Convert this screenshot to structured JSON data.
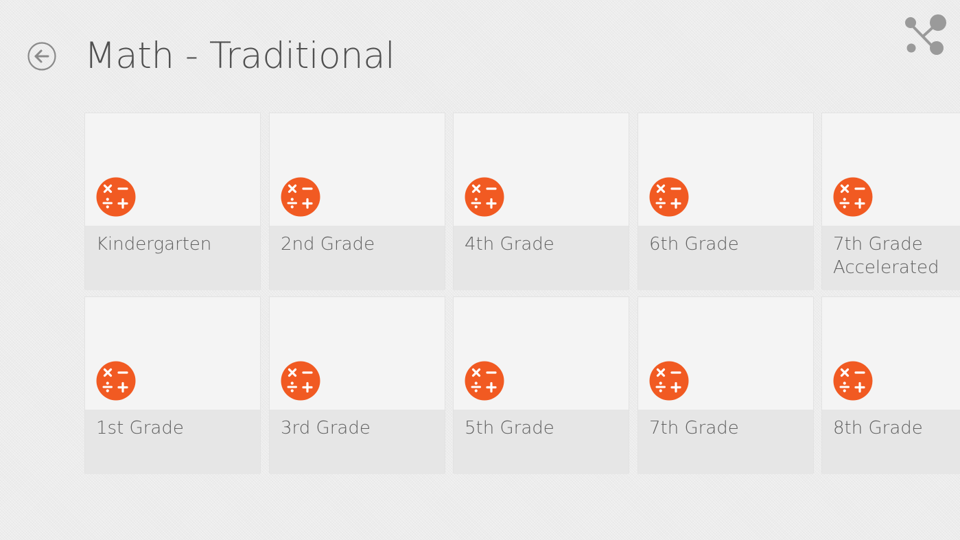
{
  "header": {
    "title": "Math - Traditional",
    "back_icon": "back-arrow-icon",
    "share_icon": "share-icon"
  },
  "colors": {
    "accent": "#f15a22",
    "title": "#505050",
    "label": "#606060",
    "tile_top": "#f4f4f4",
    "tile_bottom": "#e6e6e6"
  },
  "tiles": [
    {
      "label": "Kindergarten",
      "icon": "calculator-icon"
    },
    {
      "label": "1st Grade",
      "icon": "calculator-icon"
    },
    {
      "label": "2nd Grade",
      "icon": "calculator-icon"
    },
    {
      "label": "3rd Grade",
      "icon": "calculator-icon"
    },
    {
      "label": "4th Grade",
      "icon": "calculator-icon"
    },
    {
      "label": "5th Grade",
      "icon": "calculator-icon"
    },
    {
      "label": "6th Grade",
      "icon": "calculator-icon"
    },
    {
      "label": "7th Grade",
      "icon": "calculator-icon"
    },
    {
      "label": "7th Grade\nAccelerated",
      "icon": "calculator-icon"
    },
    {
      "label": "8th Grade",
      "icon": "calculator-icon"
    }
  ]
}
